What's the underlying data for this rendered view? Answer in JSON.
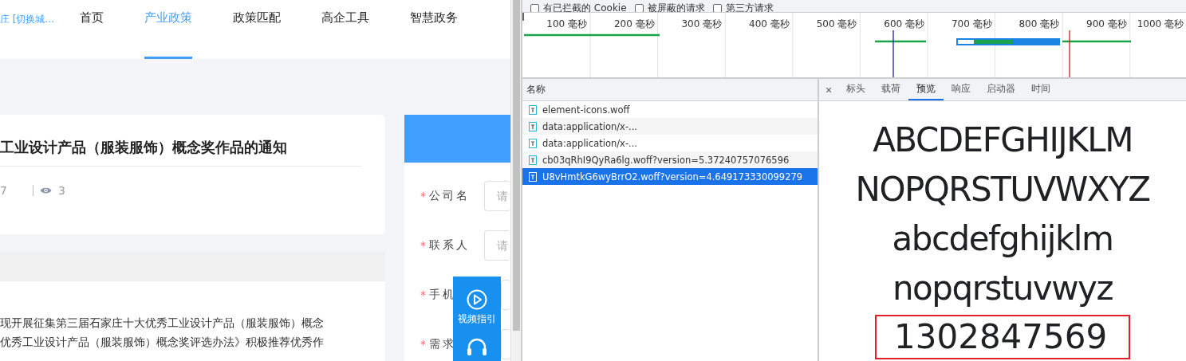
{
  "site": {
    "city_switch": "庄 [切换城...",
    "nav": [
      {
        "label": "首页",
        "selected": false
      },
      {
        "label": "产业政策",
        "selected": true
      },
      {
        "label": "政策匹配",
        "selected": false
      },
      {
        "label": "高企工具",
        "selected": false
      },
      {
        "label": "智慧政务",
        "selected": false
      }
    ],
    "article": {
      "title": "工业设计产品（服装服饰）概念奖作品的通知",
      "date": "7",
      "views": "3",
      "body": [
        "现开展征集第三届石家庄十大优秀工业设计产品（服装服饰）概念",
        "优秀工业设计产品（服装服饰）概念奖评选办法》积极推荐优秀作"
      ]
    },
    "form": {
      "required_mark": "*",
      "fields": [
        {
          "label": "公司名",
          "required": true,
          "placeholder": "请"
        },
        {
          "label": "联系人",
          "required": true,
          "placeholder": "请"
        },
        {
          "label": "手机",
          "required": true
        },
        {
          "label": "需求",
          "required": true
        }
      ]
    },
    "float_button": {
      "label": "视频指引"
    }
  },
  "devtools": {
    "filters": [
      {
        "label": "有已拦截的 Cookie",
        "checked": false
      },
      {
        "label": "被屏蔽的请求",
        "checked": false
      },
      {
        "label": "第三方请求",
        "checked": false
      }
    ],
    "timeline": {
      "ticks": [
        "100 毫秒",
        "200 毫秒",
        "300 毫秒",
        "400 毫秒",
        "500 毫秒",
        "600 毫秒",
        "700 毫秒",
        "800 毫秒",
        "900 毫秒",
        "1000 毫秒"
      ]
    },
    "requests": {
      "column": "名称",
      "rows": [
        {
          "name": "element-icons.woff",
          "selected": false
        },
        {
          "name": "data:application/x-...",
          "selected": false
        },
        {
          "name": "data:application/x-...",
          "selected": false
        },
        {
          "name": "cb03qRhI9QyRa6lg.woff?version=5.37240757076596",
          "selected": false
        },
        {
          "name": "U8vHmtkG6wyBrrO2.woff?version=4.649173330099279",
          "selected": true
        }
      ]
    },
    "detail_tabs": [
      {
        "label": "标头",
        "selected": false
      },
      {
        "label": "载荷",
        "selected": false
      },
      {
        "label": "预览",
        "selected": true
      },
      {
        "label": "响应",
        "selected": false
      },
      {
        "label": "启动器",
        "selected": false
      },
      {
        "label": "时间",
        "selected": false
      }
    ],
    "close": "×",
    "preview": {
      "lines": [
        "ABCDEFGHIJKLM",
        "NOPQRSTUVWXYZ",
        "abcdefghijklm",
        "nopqrstuvwyz"
      ],
      "digits": "1302847569",
      "digits_highlighted": true
    }
  }
}
